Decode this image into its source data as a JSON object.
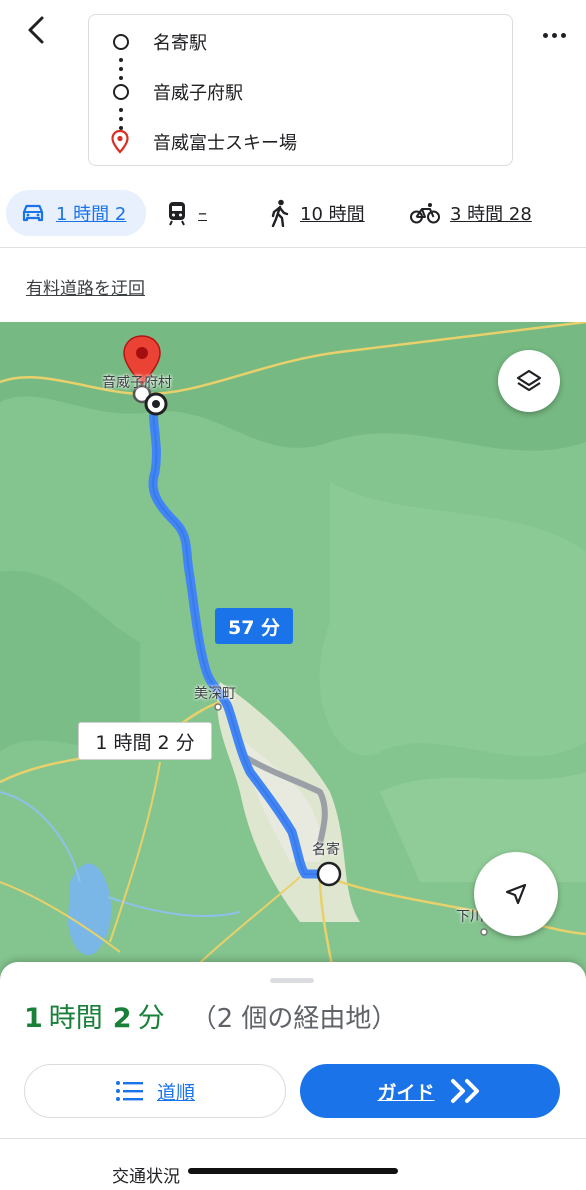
{
  "header": {
    "back_icon": "chevron-left-icon",
    "more_icon": "more-horizontal-icon",
    "stops": [
      {
        "label": "名寄駅",
        "icon": "origin-circle-icon"
      },
      {
        "label": "音威子府駅",
        "icon": "waypoint-circle-icon"
      },
      {
        "label": "音威富士スキー場",
        "icon": "destination-pin-icon"
      }
    ]
  },
  "modes": [
    {
      "name": "car",
      "icon": "car-icon",
      "label": "1 時間 2",
      "selected": true
    },
    {
      "name": "transit",
      "icon": "train-icon",
      "label": "–"
    },
    {
      "name": "walk",
      "icon": "walk-icon",
      "label": "10 時間"
    },
    {
      "name": "bike",
      "icon": "bike-icon",
      "label": "3 時間 28"
    }
  ],
  "options": {
    "avoid_tolls": "有料道路を迂回"
  },
  "map": {
    "labels": {
      "otoineppu": "音威子府村",
      "bifuka": "美深町",
      "nayoro": "名寄",
      "shimokawa": "下川町"
    },
    "route_time_primary": "57 分",
    "route_time_alt": "1 時間 2 分",
    "layers_icon": "layers-icon",
    "locate_icon": "navigation-arrow-icon",
    "colors": {
      "route": "#4285f4",
      "alt_route": "#9aa0a6",
      "land": "#7fbf8a",
      "water": "#7ab7e6",
      "pin": "#d93025"
    }
  },
  "summary": {
    "hours": "1",
    "hours_unit": "時間",
    "minutes": "2",
    "minutes_unit": "分",
    "via": "（2 個の経由地）"
  },
  "actions": {
    "steps_label": "道順",
    "steps_icon": "list-icon",
    "guide_label": "ガイド",
    "guide_icon": "double-chevron-right-icon"
  },
  "traffic_label": "交通状況"
}
